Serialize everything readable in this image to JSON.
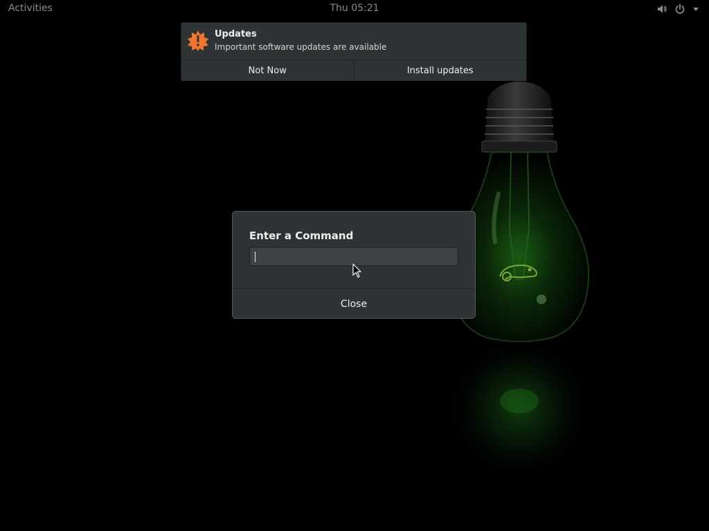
{
  "topbar": {
    "activities_label": "Activities",
    "clock": "Thu 05:21",
    "icons": [
      "volume-icon",
      "power-icon",
      "dropdown-arrow-icon"
    ]
  },
  "notification": {
    "icon": "warning-burst-icon",
    "title": "Updates",
    "body": "Important software updates are available",
    "actions": {
      "dismiss": "Not Now",
      "install": "Install updates"
    }
  },
  "run_dialog": {
    "title": "Enter a Command",
    "input_value": "",
    "close_label": "Close"
  },
  "colors": {
    "notification_icon": "#f0742e",
    "panel_bg": "#2e3436",
    "wallpaper_glow": "#1f7a1a"
  }
}
